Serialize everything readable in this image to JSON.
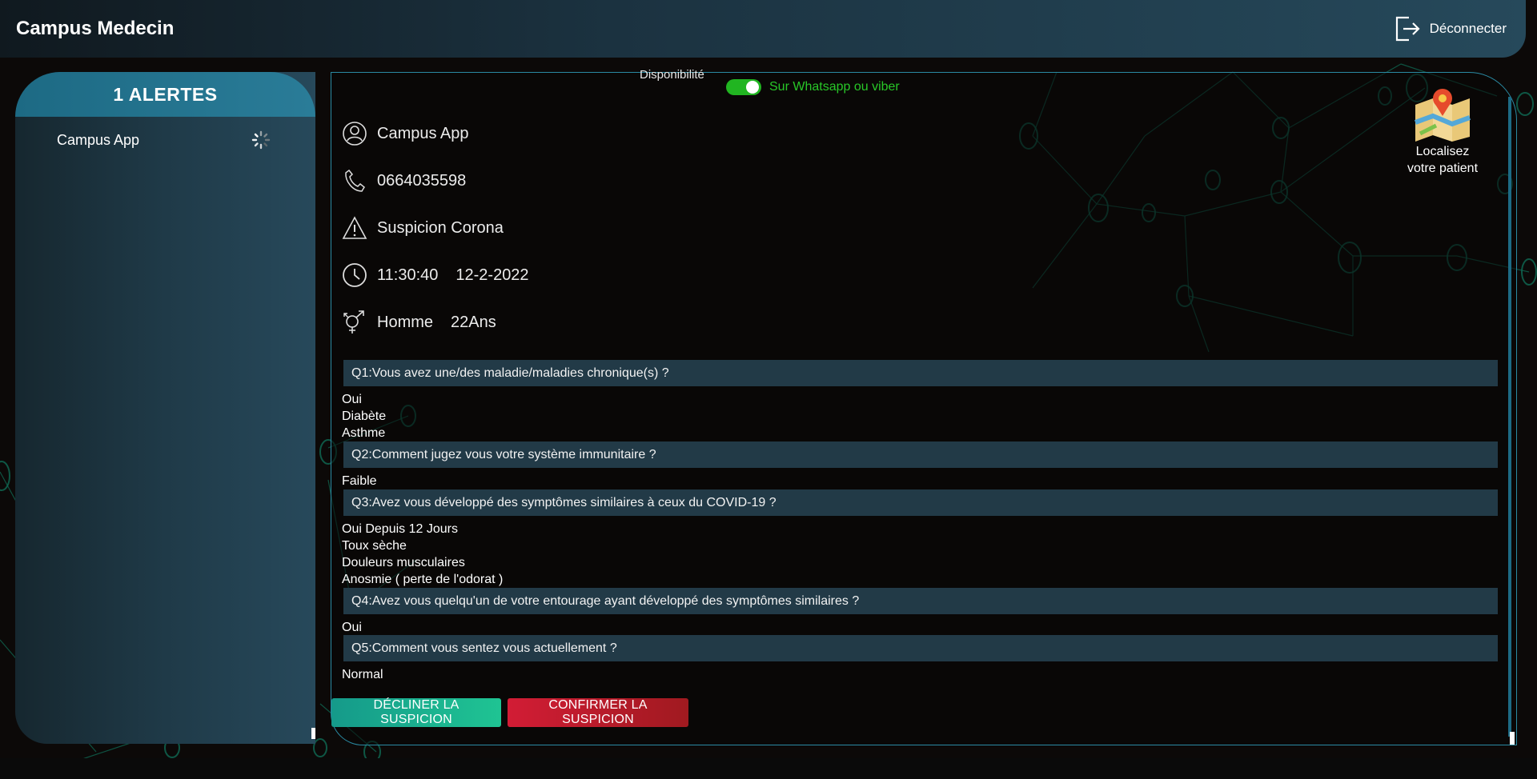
{
  "app": {
    "title": "Campus Medecin",
    "logout_label": "Déconnecter"
  },
  "alerts": {
    "header": "1 ALERTES",
    "items": [
      {
        "label": "Campus App"
      }
    ]
  },
  "detail": {
    "availability_label": "Disponibilité",
    "availability_toggle_text": "Sur Whatsapp ou viber",
    "availability_on": true,
    "map_button_label": "Localisez votre patient",
    "patient_name": "Campus App",
    "phone": "0664035598",
    "suspicion": "Suspicion Corona",
    "time": "11:30:40",
    "date": "12-2-2022",
    "gender": "Homme",
    "age": "22Ans",
    "questions": [
      {
        "question": "Q1:Vous avez une/des maladie/maladies chronique(s) ?",
        "answers": [
          "Oui",
          "Diabète",
          "Asthme"
        ]
      },
      {
        "question": "Q2:Comment jugez vous votre système immunitaire ?",
        "answers": [
          "Faible"
        ]
      },
      {
        "question": "Q3:Avez vous développé des symptômes similaires à ceux du COVID-19 ?",
        "answers": [
          "Oui Depuis 12 Jours",
          "Toux sèche",
          "Douleurs musculaires",
          "Anosmie ( perte de l'odorat )"
        ]
      },
      {
        "question": "Q4:Avez vous quelqu'un de votre entourage ayant développé des symptômes similaires ?",
        "answers": [
          "Oui"
        ]
      },
      {
        "question": "Q5:Comment vous sentez vous actuellement ?",
        "answers": [
          "Normal"
        ]
      }
    ],
    "decline_label": "DÉCLINER LA SUSPICION",
    "confirm_label": "CONFIRMER LA SUSPICION"
  },
  "colors": {
    "accent": "#1d6a84",
    "toggle_on": "#21b521",
    "decline": "#1fc493",
    "confirm": "#d21c35"
  },
  "icons": [
    "logout-icon",
    "user-icon",
    "phone-icon",
    "warning-icon",
    "clock-icon",
    "gender-icon",
    "map-icon",
    "spinner-icon"
  ]
}
